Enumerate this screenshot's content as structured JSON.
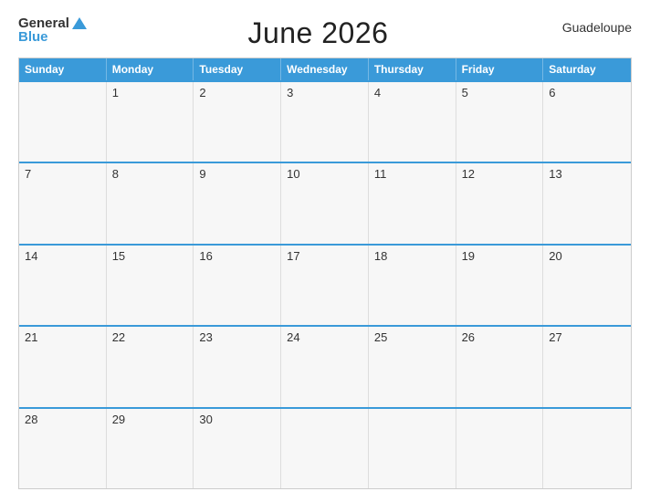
{
  "logo": {
    "general": "General",
    "blue": "Blue"
  },
  "title": "June 2026",
  "region": "Guadeloupe",
  "days_of_week": [
    "Sunday",
    "Monday",
    "Tuesday",
    "Wednesday",
    "Thursday",
    "Friday",
    "Saturday"
  ],
  "weeks": [
    [
      {
        "day": "",
        "empty": true
      },
      {
        "day": "1",
        "empty": false
      },
      {
        "day": "2",
        "empty": false
      },
      {
        "day": "3",
        "empty": false
      },
      {
        "day": "4",
        "empty": false
      },
      {
        "day": "5",
        "empty": false
      },
      {
        "day": "6",
        "empty": false
      }
    ],
    [
      {
        "day": "7",
        "empty": false
      },
      {
        "day": "8",
        "empty": false
      },
      {
        "day": "9",
        "empty": false
      },
      {
        "day": "10",
        "empty": false
      },
      {
        "day": "11",
        "empty": false
      },
      {
        "day": "12",
        "empty": false
      },
      {
        "day": "13",
        "empty": false
      }
    ],
    [
      {
        "day": "14",
        "empty": false
      },
      {
        "day": "15",
        "empty": false
      },
      {
        "day": "16",
        "empty": false
      },
      {
        "day": "17",
        "empty": false
      },
      {
        "day": "18",
        "empty": false
      },
      {
        "day": "19",
        "empty": false
      },
      {
        "day": "20",
        "empty": false
      }
    ],
    [
      {
        "day": "21",
        "empty": false
      },
      {
        "day": "22",
        "empty": false
      },
      {
        "day": "23",
        "empty": false
      },
      {
        "day": "24",
        "empty": false
      },
      {
        "day": "25",
        "empty": false
      },
      {
        "day": "26",
        "empty": false
      },
      {
        "day": "27",
        "empty": false
      }
    ],
    [
      {
        "day": "28",
        "empty": false
      },
      {
        "day": "29",
        "empty": false
      },
      {
        "day": "30",
        "empty": false
      },
      {
        "day": "",
        "empty": true
      },
      {
        "day": "",
        "empty": true
      },
      {
        "day": "",
        "empty": true
      },
      {
        "day": "",
        "empty": true
      }
    ]
  ]
}
